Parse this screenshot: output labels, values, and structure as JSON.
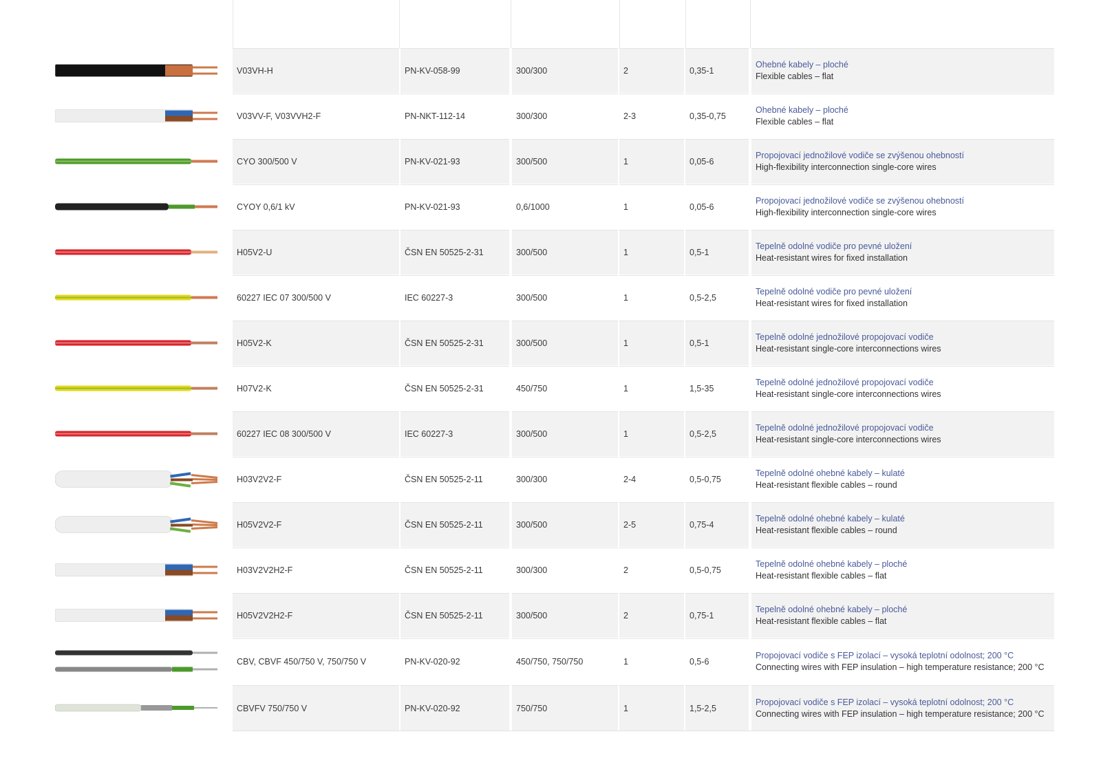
{
  "rows": [
    {
      "type": "V03VH-H",
      "standard": "PN-KV-058-99",
      "voltage": "300/300",
      "cores": "2",
      "section": "0,35-1",
      "desc_cz": "Ohebné kabely – ploché",
      "desc_en": "Flexible cables – flat"
    },
    {
      "type": "V03VV-F, V03VVH2-F",
      "standard": "PN-NKT-112-14",
      "voltage": "300/300",
      "cores": "2-3",
      "section": "0,35-0,75",
      "desc_cz": "Ohebné kabely – ploché",
      "desc_en": "Flexible cables – flat"
    },
    {
      "type": "CYO 300/500 V",
      "standard": "PN-KV-021-93",
      "voltage": "300/500",
      "cores": "1",
      "section": "0,05-6",
      "desc_cz": "Propojovací jednožilové vodiče se zvýšenou ohebností",
      "desc_en": "High-flexibility interconnection single-core wires"
    },
    {
      "type": "CYOY 0,6/1 kV",
      "standard": "PN-KV-021-93",
      "voltage": "0,6/1000",
      "cores": "1",
      "section": "0,05-6",
      "desc_cz": "Propojovací jednožilové vodiče se zvýšenou ohebností",
      "desc_en": "High-flexibility interconnection single-core wires"
    },
    {
      "type": "H05V2-U",
      "standard": "ČSN EN 50525-2-31",
      "voltage": "300/500",
      "cores": "1",
      "section": "0,5-1",
      "desc_cz": "Tepelně odolné vodiče pro pevné uložení",
      "desc_en": "Heat-resistant wires for fixed installation"
    },
    {
      "type": "60227 IEC 07 300/500 V",
      "standard": "IEC 60227-3",
      "voltage": "300/500",
      "cores": "1",
      "section": "0,5-2,5",
      "desc_cz": "Tepelně odolné vodiče pro pevné uložení",
      "desc_en": "Heat-resistant wires for fixed installation"
    },
    {
      "type": "H05V2-K",
      "standard": "ČSN EN 50525-2-31",
      "voltage": "300/500",
      "cores": "1",
      "section": "0,5-1",
      "desc_cz": "Tepelně odolné jednožilové propojovací vodiče",
      "desc_en": "Heat-resistant single-core interconnections wires"
    },
    {
      "type": "H07V2-K",
      "standard": "ČSN EN 50525-2-31",
      "voltage": "450/750",
      "cores": "1",
      "section": "1,5-35",
      "desc_cz": "Tepelně odolné jednožilové propojovací vodiče",
      "desc_en": "Heat-resistant single-core interconnections wires"
    },
    {
      "type": "60227 IEC 08 300/500 V",
      "standard": "IEC 60227-3",
      "voltage": "300/500",
      "cores": "1",
      "section": "0,5-2,5",
      "desc_cz": "Tepelně odolné jednožilové propojovací vodiče",
      "desc_en": "Heat-resistant single-core interconnections wires"
    },
    {
      "type": "H03V2V2-F",
      "standard": "ČSN EN 50525-2-11",
      "voltage": "300/300",
      "cores": "2-4",
      "section": "0,5-0,75",
      "desc_cz": "Tepelně odolné ohebné kabely – kulaté",
      "desc_en": "Heat-resistant flexible cables – round"
    },
    {
      "type": "H05V2V2-F",
      "standard": "ČSN EN 50525-2-11",
      "voltage": "300/500",
      "cores": "2-5",
      "section": "0,75-4",
      "desc_cz": "Tepelně odolné ohebné kabely – kulaté",
      "desc_en": "Heat-resistant flexible cables – round"
    },
    {
      "type": "H03V2V2H2-F",
      "standard": "ČSN EN 50525-2-11",
      "voltage": "300/300",
      "cores": "2",
      "section": "0,5-0,75",
      "desc_cz": "Tepelně odolné ohebné kabely – ploché",
      "desc_en": "Heat-resistant flexible cables – flat"
    },
    {
      "type": "H05V2V2H2-F",
      "standard": "ČSN EN 50525-2-11",
      "voltage": "300/500",
      "cores": "2",
      "section": "0,75-1",
      "desc_cz": "Tepelně odolné ohebné kabely – ploché",
      "desc_en": "Heat-resistant flexible cables – flat"
    },
    {
      "type": "CBV, CBVF 450/750 V, 750/750 V",
      "standard": "PN-KV-020-92",
      "voltage": "450/750, 750/750",
      "cores": "1",
      "section": "0,5-6",
      "desc_cz": "Propojovací vodiče s FEP izolací – vysoká teplotní odolnost; 200 °C",
      "desc_en": "Connecting wires with FEP insulation – high temperature resistance; 200 °C"
    },
    {
      "type": "CBVFV 750/750 V",
      "standard": "PN-KV-020-92",
      "voltage": "750/750",
      "cores": "1",
      "section": "1,5-2,5",
      "desc_cz": "Propojovací vodiče s FEP izolací – vysoká teplotní odolnost; 200 °C",
      "desc_en": "Connecting wires with FEP insulation – high temperature resistance; 200 °C"
    }
  ],
  "cable_images": [
    {
      "kind": "flat2",
      "sheath": "#111111",
      "cores": [
        "#c8703f",
        "#c8703f"
      ]
    },
    {
      "kind": "flat2",
      "sheath": "#eeeeee",
      "cores": [
        "#2f67b5",
        "#8a4a22"
      ]
    },
    {
      "kind": "wire",
      "insul": "#4c9a2c",
      "stripe": "#a6d07a",
      "tip": "#d07a50"
    },
    {
      "kind": "wire2",
      "insul": "#222222",
      "inner": "#4c9a2c",
      "tip": "#d07a50"
    },
    {
      "kind": "wire",
      "insul": "#d8242b",
      "stripe": "#f0a0a0",
      "tip": "#e0b080"
    },
    {
      "kind": "wire",
      "insul": "#e6d81c",
      "stripe": "#6cb040",
      "tip": "#d07a50"
    },
    {
      "kind": "wire",
      "insul": "#d8242b",
      "stripe": "#f0a0a0",
      "tip": "#c08060"
    },
    {
      "kind": "wire",
      "insul": "#e6d81c",
      "stripe": "#6cb040",
      "tip": "#c08060"
    },
    {
      "kind": "wire",
      "insul": "#d8242b",
      "stripe": "#f0a0a0",
      "tip": "#c08060"
    },
    {
      "kind": "round",
      "sheath": "#eeeeee",
      "cores": [
        "#2f67b5",
        "#8a4a22",
        "#6cb040"
      ]
    },
    {
      "kind": "round",
      "sheath": "#eeeeee",
      "cores": [
        "#2f67b5",
        "#8a4a22",
        "#6cb040"
      ]
    },
    {
      "kind": "flat2",
      "sheath": "#eeeeee",
      "cores": [
        "#2f67b5",
        "#8a4a22"
      ]
    },
    {
      "kind": "flat2",
      "sheath": "#eeeeee",
      "cores": [
        "#2f67b5",
        "#8a4a22"
      ]
    },
    {
      "kind": "double",
      "top": "#333333",
      "bottom": "#888888",
      "inner": "#4c9a2c"
    },
    {
      "kind": "fep",
      "sheath": "#dfe4d8",
      "braid": "#999999",
      "inner": "#4c9a2c"
    }
  ]
}
